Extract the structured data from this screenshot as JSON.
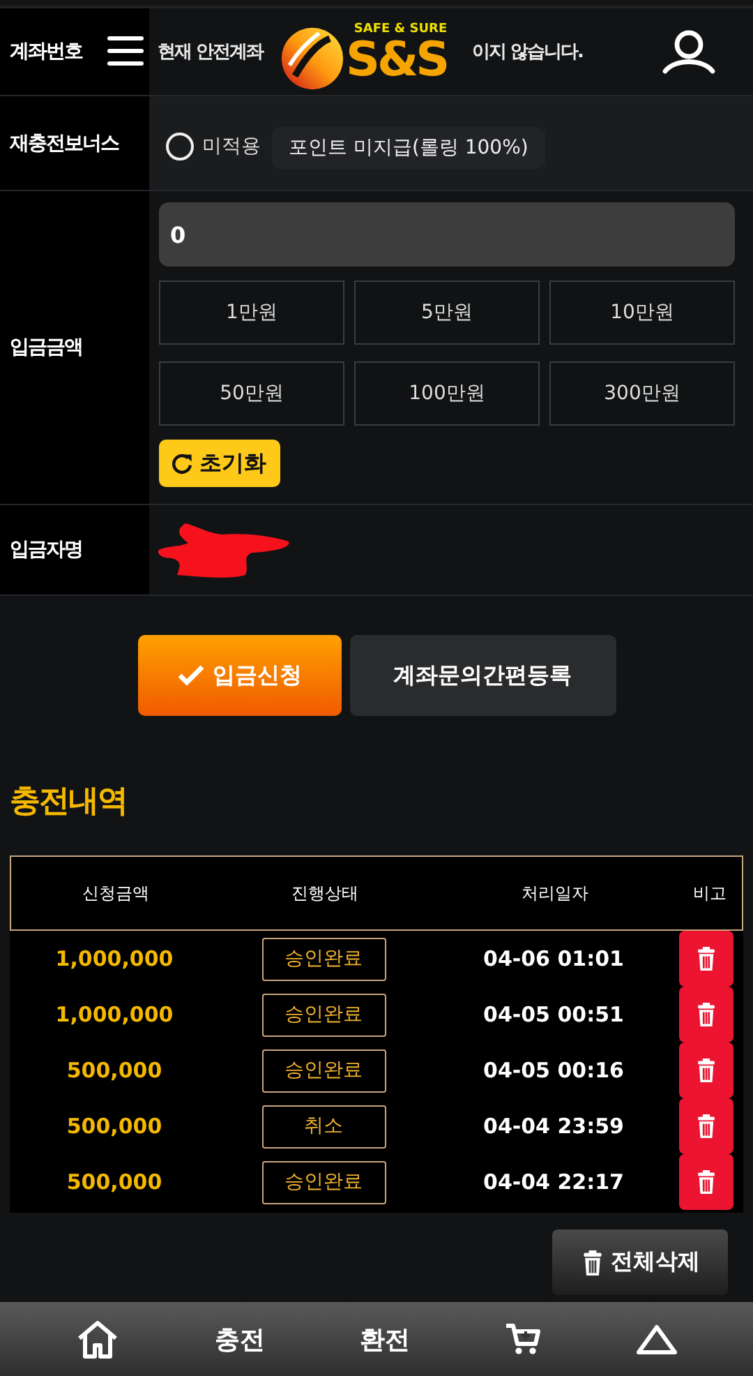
{
  "header": {
    "account_label": "계좌번호",
    "notice_start": "현재 안전계좌",
    "notice_end": "이지 않습니다.",
    "logo": {
      "tagline": "SAFE & SURE",
      "name": "S&S"
    }
  },
  "form": {
    "bonus": {
      "label": "재충전보너스",
      "option": {
        "label": "미적용",
        "selected": false
      },
      "note": "포인트 미지급(롤링 100%)"
    },
    "amount": {
      "label": "입금금액",
      "value": "0",
      "quick_amounts": [
        "1만원",
        "5만원",
        "10만원",
        "50만원",
        "100만원",
        "300만원"
      ],
      "reset": "초기화"
    },
    "depositor": {
      "label": "입금자명"
    }
  },
  "actions": [
    {
      "label": "입금신청",
      "kind": "primary"
    },
    {
      "label": "계좌문의간편등록",
      "kind": "secondary"
    }
  ],
  "history": {
    "title": "충전내역",
    "columns": [
      "신청금액",
      "진행상태",
      "처리일자",
      "비고"
    ],
    "rows": [
      {
        "amount": "1,000,000",
        "status": "승인완료",
        "date": "04-06 01:01"
      },
      {
        "amount": "1,000,000",
        "status": "승인완료",
        "date": "04-05 00:51"
      },
      {
        "amount": "500,000",
        "status": "승인완료",
        "date": "04-05 00:16"
      },
      {
        "amount": "500,000",
        "status": "취소",
        "date": "04-04 23:59"
      },
      {
        "amount": "500,000",
        "status": "승인완료",
        "date": "04-04 22:17"
      }
    ],
    "delete_all": "전체삭제"
  },
  "bottom_nav": [
    {
      "kind": "home"
    },
    {
      "kind": "text",
      "label": "충전"
    },
    {
      "kind": "text",
      "label": "환전"
    },
    {
      "kind": "cart"
    },
    {
      "kind": "top"
    }
  ]
}
